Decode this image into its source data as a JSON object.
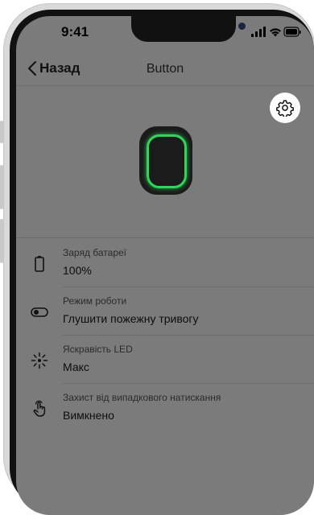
{
  "status_bar": {
    "time": "9:41"
  },
  "nav": {
    "back_label": "Назад",
    "title": "Button"
  },
  "device": {
    "name": "Button",
    "ring_color": "#2fd65a"
  },
  "settings_rows": [
    {
      "label": "Заряд батареї",
      "value": "100%",
      "icon": "battery-icon"
    },
    {
      "label": "Режим роботи",
      "value": "Глушити пожежну тривогу",
      "icon": "toggle-icon"
    },
    {
      "label": "Яскравість LED",
      "value": "Макс",
      "icon": "brightness-icon"
    },
    {
      "label": "Захист від випадкового натискання",
      "value": "Вимкнено",
      "icon": "tap-hand-icon"
    }
  ]
}
